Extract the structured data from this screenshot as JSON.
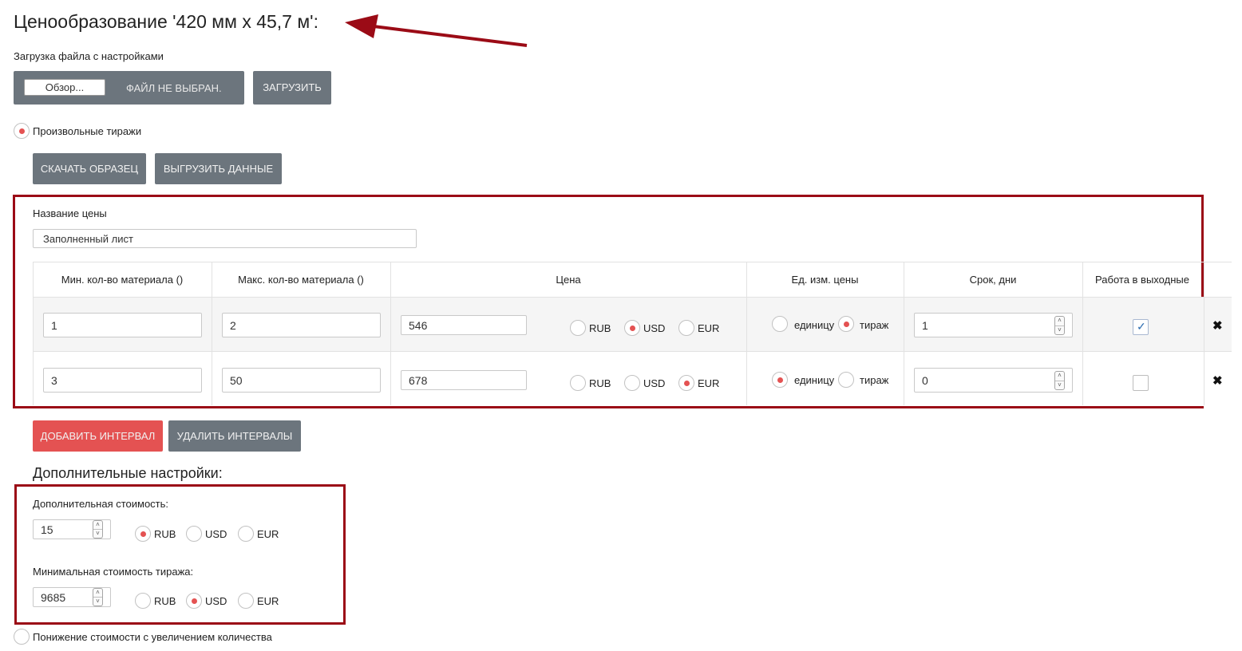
{
  "page": {
    "title": "Ценообразование '420 мм х 45,7 м':"
  },
  "upload": {
    "label": "Загрузка файла с настройками",
    "browse_label": "Обзор...",
    "file_status": "ФАЙЛ НЕ ВЫБРАН.",
    "upload_button": "ЗАГРУЗИТЬ"
  },
  "mode": {
    "arbitrary_runs_label": "Произвольные тиражи",
    "arbitrary_runs_selected": true
  },
  "actions": {
    "download_sample": "СКАЧАТЬ ОБРАЗЕЦ",
    "export_data": "ВЫГРУЗИТЬ ДАННЫЕ"
  },
  "price": {
    "name_label": "Название цены",
    "name_value": "Заполненный лист"
  },
  "table": {
    "headers": [
      "Мин. кол-во материала ()",
      "Макс. кол-во материала ()",
      "Цена",
      "Ед. изм. цены",
      "Срок, дни",
      "Работа в выходные"
    ],
    "currencies": [
      "RUB",
      "USD",
      "EUR"
    ],
    "unit_options": [
      "единицу",
      "тираж"
    ],
    "rows": [
      {
        "min": "1",
        "max": "2",
        "price": "546",
        "currency": "USD",
        "unit": "тираж",
        "days": "1",
        "weekends": true
      },
      {
        "min": "3",
        "max": "50",
        "price": "678",
        "currency": "EUR",
        "unit": "единицу",
        "days": "0",
        "weekends": false
      }
    ]
  },
  "interval_actions": {
    "add": "ДОБАВИТЬ ИНТЕРВАЛ",
    "delete": "УДАЛИТЬ ИНТЕРВАЛЫ"
  },
  "extra": {
    "title": "Дополнительные настройки:",
    "additional_cost_label": "Дополнительная стоимость:",
    "additional_cost_value": "15",
    "additional_cost_currency": "RUB",
    "min_run_cost_label": "Минимальная стоимость тиража:",
    "min_run_cost_value": "9685",
    "min_run_cost_currency": "USD"
  },
  "discount": {
    "label": "Понижение стоимости с увеличением количества",
    "selected": false
  },
  "colors": {
    "accent_red": "#e45252",
    "frame_red": "#9b0b16",
    "button_gray": "#6c757d"
  },
  "icons": {
    "delete_row": "close-x-icon",
    "spinner": "spinner-arrows-icon",
    "check": "check-icon"
  }
}
